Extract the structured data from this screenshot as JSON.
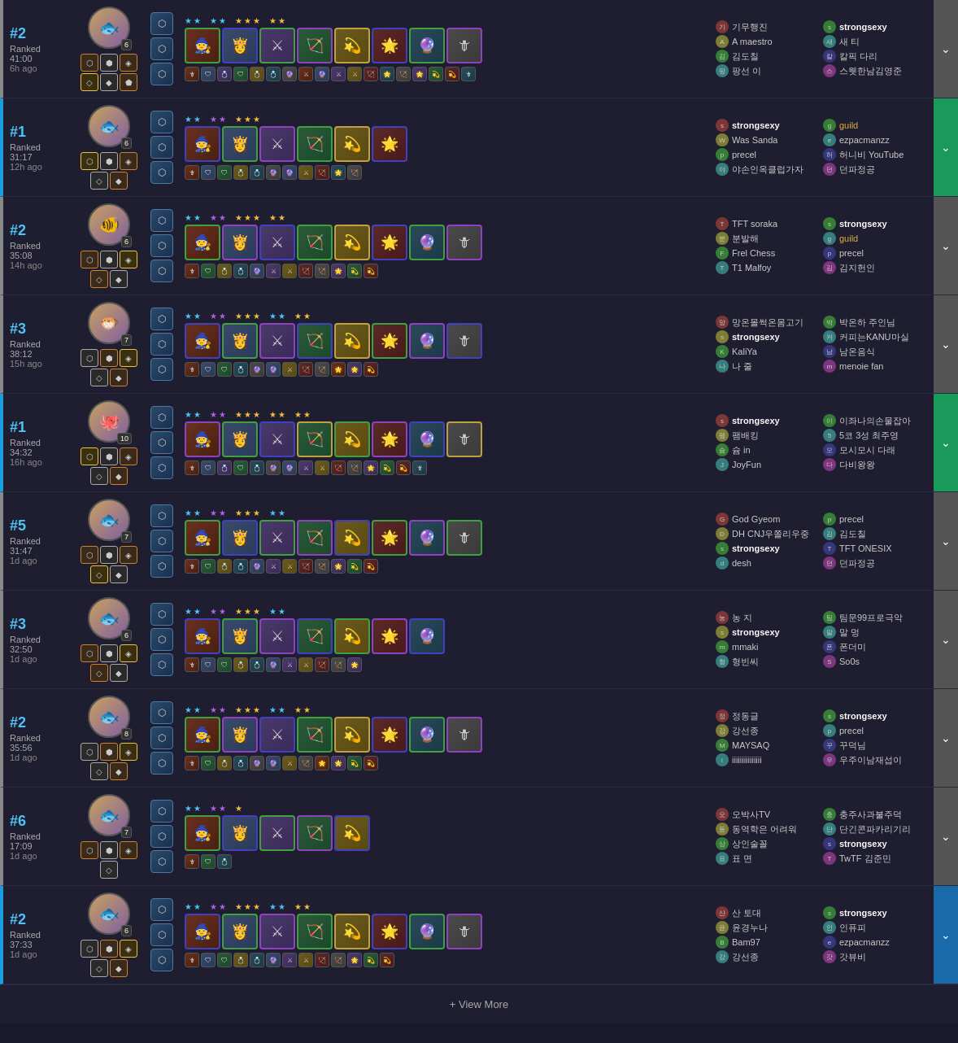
{
  "matches": [
    {
      "id": "match1",
      "rank": "#2",
      "rank_color": "blue",
      "type": "Ranked",
      "duration": "41:00",
      "ago": "6h ago",
      "avatar_emoji": "🐟",
      "avatar_level": 6,
      "traits": [
        "bronze",
        "silver",
        "bronze",
        "gold",
        "silver",
        "bronze"
      ],
      "augments": [
        "⬡",
        "⬡",
        "⬡"
      ],
      "stars_groups": [
        {
          "stars": 2,
          "color": "blue"
        },
        {
          "stars": 2,
          "color": "blue"
        },
        {
          "stars": 3,
          "color": "yellow"
        },
        {
          "stars": 2,
          "color": "yellow"
        }
      ],
      "champions": [
        "🧙",
        "👸",
        "🗡",
        "🏹",
        "💫",
        "🌟",
        "⚔",
        "🔮"
      ],
      "champ_tiers": [
        "tier2",
        "tier3",
        "tier2",
        "tier4",
        "tier5",
        "tier3",
        "tier2",
        "tier4"
      ],
      "items": [
        [
          "🗡",
          "🛡",
          "💍"
        ],
        [
          "🗡",
          "🔮"
        ],
        [
          "💍",
          "⚔",
          "🛡"
        ],
        [
          "🗡",
          "💍"
        ],
        [
          "💍",
          "🔮",
          "⚔"
        ],
        [
          "🗡"
        ],
        [
          "🛡",
          "💍"
        ],
        [
          "🔮",
          "⚔"
        ]
      ],
      "players_left": [
        "기무행진",
        "A maestro",
        "김도칠",
        "팡선 이"
      ],
      "players_right": [
        "strongsexy",
        "새 티",
        "칼픽 다리",
        "스웻한남김영준"
      ],
      "expand_color": "gray",
      "result": "loss"
    },
    {
      "id": "match2",
      "rank": "#1",
      "rank_color": "blue",
      "type": "Ranked",
      "duration": "31:17",
      "ago": "12h ago",
      "avatar_emoji": "🐟",
      "avatar_level": 6,
      "traits": [
        "gold",
        "silver",
        "bronze",
        "silver",
        "bronze"
      ],
      "augments": [
        "⬡",
        "⬡",
        "⬡"
      ],
      "stars_groups": [
        {
          "stars": 2,
          "color": "blue"
        },
        {
          "stars": 2,
          "color": "purple"
        },
        {
          "stars": 3,
          "color": "yellow"
        }
      ],
      "champions": [
        "🧙",
        "👸",
        "🗡",
        "🏹",
        "💫",
        "🌟"
      ],
      "champ_tiers": [
        "tier3",
        "tier2",
        "tier4",
        "tier2",
        "tier5",
        "tier3"
      ],
      "items": [
        [
          "🗡",
          "🛡"
        ],
        [
          "💍",
          "🔮"
        ],
        [
          "⚔",
          "💍"
        ],
        [
          "🗡"
        ],
        [
          "💍",
          "🔮",
          "⚔"
        ],
        [
          "🛡"
        ]
      ],
      "players_left": [
        "strongsexy",
        "Was Sanda",
        "precel",
        "야손인옥클럽가자"
      ],
      "players_right": [
        "guild",
        "ezpacmanzz",
        "허니비 YouTube",
        "던파정공"
      ],
      "expand_color": "green",
      "result": "win"
    },
    {
      "id": "match3",
      "rank": "#2",
      "rank_color": "blue",
      "type": "Ranked",
      "duration": "35:08",
      "ago": "14h ago",
      "avatar_emoji": "🐠",
      "avatar_level": 6,
      "traits": [
        "bronze",
        "silver",
        "gold",
        "bronze",
        "silver"
      ],
      "augments": [
        "⬡",
        "⬡",
        "⬡"
      ],
      "stars_groups": [
        {
          "stars": 2,
          "color": "blue"
        },
        {
          "stars": 2,
          "color": "purple"
        },
        {
          "stars": 3,
          "color": "yellow"
        },
        {
          "stars": 2,
          "color": "yellow"
        }
      ],
      "champions": [
        "🧙",
        "👸",
        "🗡",
        "🏹",
        "💫",
        "🌟",
        "⚔",
        "🔮"
      ],
      "champ_tiers": [
        "tier2",
        "tier4",
        "tier3",
        "tier2",
        "tier5",
        "tier3",
        "tier2",
        "tier4"
      ],
      "items": [
        [
          "🗡"
        ],
        [
          "🛡",
          "💍"
        ],
        [
          "🔮"
        ],
        [
          "🗡",
          "⚔"
        ],
        [
          "💍",
          "🔮"
        ],
        [
          "🛡"
        ],
        [
          "⚔",
          "💍"
        ],
        [
          "🔮"
        ]
      ],
      "players_left": [
        "TFT soraka",
        "분발해",
        "Frel Chess",
        "T1 Malfoy"
      ],
      "players_right": [
        "strongsexy",
        "guild",
        "precel",
        "김지헌인"
      ],
      "expand_color": "gray",
      "result": "loss"
    },
    {
      "id": "match4",
      "rank": "#3",
      "rank_color": "blue",
      "type": "Ranked",
      "duration": "38:12",
      "ago": "15h ago",
      "avatar_emoji": "🐡",
      "avatar_level": 7,
      "traits": [
        "silver",
        "bronze",
        "gold",
        "silver",
        "bronze"
      ],
      "augments": [
        "⬡",
        "⬡",
        "⬡"
      ],
      "stars_groups": [
        {
          "stars": 2,
          "color": "blue"
        },
        {
          "stars": 2,
          "color": "purple"
        },
        {
          "stars": 3,
          "color": "yellow"
        },
        {
          "stars": 2,
          "color": "blue"
        },
        {
          "stars": 2,
          "color": "yellow"
        }
      ],
      "champions": [
        "🧙",
        "👸",
        "🗡",
        "🏹",
        "💫",
        "🌟",
        "⚔",
        "🔮"
      ],
      "champ_tiers": [
        "tier3",
        "tier2",
        "tier4",
        "tier3",
        "tier5",
        "tier2",
        "tier4",
        "tier3"
      ],
      "items": [
        [
          "🗡",
          "🛡"
        ],
        [
          "💍"
        ],
        [
          "🔮",
          "⚔"
        ],
        [
          "🗡"
        ],
        [
          "💍",
          "🔮"
        ],
        [
          "🛡",
          "⚔"
        ],
        [
          "💍"
        ],
        [
          "🔮"
        ]
      ],
      "players_left": [
        "망온몰썩온몸고기",
        "strongsexy",
        "KaliYa",
        "나 줄"
      ],
      "players_right": [
        "박온하 주인님",
        "커피는KANU마실",
        "남온음식",
        "menoie fan"
      ],
      "expand_color": "gray",
      "result": "loss"
    },
    {
      "id": "match5",
      "rank": "#1",
      "rank_color": "blue",
      "type": "Ranked",
      "duration": "34:32",
      "ago": "16h ago",
      "avatar_emoji": "🐙",
      "avatar_level": 10,
      "traits": [
        "gold",
        "silver",
        "bronze",
        "silver",
        "bronze"
      ],
      "augments": [
        "⬡",
        "⬡",
        "⬡"
      ],
      "stars_groups": [
        {
          "stars": 2,
          "color": "blue"
        },
        {
          "stars": 2,
          "color": "purple"
        },
        {
          "stars": 3,
          "color": "yellow"
        },
        {
          "stars": 2,
          "color": "yellow"
        },
        {
          "stars": 2,
          "color": "yellow"
        }
      ],
      "champions": [
        "🧙",
        "👸",
        "🗡",
        "🏹",
        "💫",
        "🌟",
        "⚔",
        "🔮"
      ],
      "champ_tiers": [
        "tier4",
        "tier2",
        "tier3",
        "tier5",
        "tier2",
        "tier4",
        "tier3",
        "tier5"
      ],
      "items": [
        [
          "🗡",
          "🛡",
          "💍"
        ],
        [
          "🔮"
        ],
        [
          "⚔",
          "💍"
        ],
        [
          "🗡",
          "🛡"
        ],
        [
          "💍",
          "🔮"
        ],
        [
          "⚔"
        ],
        [
          "🗡",
          "💍"
        ],
        [
          "🔮",
          "⚔"
        ]
      ],
      "players_left": [
        "strongsexy",
        "팸배킹",
        "슘 in",
        "JoyFun"
      ],
      "players_right": [
        "이좌나의손물잡아",
        "5코 3성 최주영",
        "모시모시 다래",
        "다비왕왕"
      ],
      "expand_color": "green",
      "result": "win"
    },
    {
      "id": "match6",
      "rank": "#5",
      "rank_color": "blue",
      "type": "Ranked",
      "duration": "31:47",
      "ago": "1d ago",
      "avatar_emoji": "🐟",
      "avatar_level": 7,
      "traits": [
        "bronze",
        "silver",
        "bronze",
        "gold",
        "silver"
      ],
      "augments": [
        "⬡",
        "⬡",
        "⬡"
      ],
      "stars_groups": [
        {
          "stars": 2,
          "color": "blue"
        },
        {
          "stars": 2,
          "color": "purple"
        },
        {
          "stars": 3,
          "color": "yellow"
        },
        {
          "stars": 2,
          "color": "blue"
        }
      ],
      "champions": [
        "🧙",
        "👸",
        "🗡",
        "🏹",
        "💫",
        "🌟",
        "⚔",
        "🔮"
      ],
      "champ_tiers": [
        "tier2",
        "tier3",
        "tier2",
        "tier4",
        "tier3",
        "tier2",
        "tier4",
        "tier2"
      ],
      "items": [
        [
          "🗡"
        ],
        [
          "🛡",
          "💍"
        ],
        [
          "🔮"
        ],
        [
          "⚔",
          "💍"
        ],
        [
          "🗡",
          "🔮"
        ],
        [
          "🛡"
        ],
        [
          "💍",
          "⚔"
        ],
        [
          "🔮"
        ]
      ],
      "players_left": [
        "God Gyeom",
        "DH CNJ우쫄리우중",
        "strongsexy",
        "desh"
      ],
      "players_right": [
        "precel",
        "김도칠",
        "TFT ONESIX",
        "던파정공"
      ],
      "expand_color": "gray",
      "result": "loss"
    },
    {
      "id": "match7",
      "rank": "#3",
      "rank_color": "blue",
      "type": "Ranked",
      "duration": "32:50",
      "ago": "1d ago",
      "avatar_emoji": "🐟",
      "avatar_level": 6,
      "traits": [
        "bronze",
        "silver",
        "gold",
        "bronze",
        "silver"
      ],
      "augments": [
        "⬡",
        "⬡",
        "⬡"
      ],
      "stars_groups": [
        {
          "stars": 2,
          "color": "blue"
        },
        {
          "stars": 2,
          "color": "purple"
        },
        {
          "stars": 3,
          "color": "yellow"
        },
        {
          "stars": 2,
          "color": "blue"
        }
      ],
      "champions": [
        "🧙",
        "👸",
        "🗡",
        "🏹",
        "💫",
        "🌟",
        "⚔"
      ],
      "champ_tiers": [
        "tier3",
        "tier2",
        "tier4",
        "tier3",
        "tier2",
        "tier4",
        "tier3"
      ],
      "items": [
        [
          "🗡",
          "🛡"
        ],
        [
          "💍",
          "🔮"
        ],
        [
          "⚔"
        ],
        [
          "🗡",
          "💍"
        ],
        [
          "🔮",
          "⚔"
        ],
        [
          "🛡"
        ],
        [
          "💍"
        ]
      ],
      "players_left": [
        "농 지",
        "strongsexy",
        "mmaki",
        "형빈씨"
      ],
      "players_right": [
        "팀문99프로극악",
        "말 멍",
        "폰더미",
        "So0s"
      ],
      "expand_color": "gray",
      "result": "loss"
    },
    {
      "id": "match8",
      "rank": "#2",
      "rank_color": "blue",
      "type": "Ranked",
      "duration": "35:56",
      "ago": "1d ago",
      "avatar_emoji": "🐟",
      "avatar_level": 8,
      "traits": [
        "silver",
        "bronze",
        "gold",
        "silver",
        "bronze"
      ],
      "augments": [
        "⬡",
        "⬡",
        "⬡"
      ],
      "stars_groups": [
        {
          "stars": 2,
          "color": "blue"
        },
        {
          "stars": 2,
          "color": "purple"
        },
        {
          "stars": 3,
          "color": "yellow"
        },
        {
          "stars": 2,
          "color": "blue"
        },
        {
          "stars": 2,
          "color": "yellow"
        }
      ],
      "champions": [
        "🧙",
        "👸",
        "🗡",
        "🏹",
        "💫",
        "🌟",
        "⚔",
        "🔮"
      ],
      "champ_tiers": [
        "tier2",
        "tier4",
        "tier3",
        "tier2",
        "tier5",
        "tier3",
        "tier2",
        "tier4"
      ],
      "items": [
        [
          "🗡"
        ],
        [
          "🛡",
          "💍"
        ],
        [
          "🔮",
          "⚔"
        ],
        [
          "🗡"
        ],
        [
          "💍"
        ],
        [
          "🔮",
          "⚔"
        ],
        [
          "🛡",
          "💍"
        ],
        [
          "🔮"
        ]
      ],
      "players_left": [
        "정동글",
        "강선종",
        "MAYSAQ",
        "iiiiiiiiiiiiiii"
      ],
      "players_right": [
        "strongsexy",
        "precel",
        "꾸덕님",
        "우주이남재섭이"
      ],
      "expand_color": "gray",
      "result": "loss"
    },
    {
      "id": "match9",
      "rank": "#6",
      "rank_color": "blue",
      "type": "Ranked",
      "duration": "17:09",
      "ago": "1d ago",
      "avatar_emoji": "🐟",
      "avatar_level": 7,
      "traits": [
        "bronze",
        "silver",
        "bronze",
        "silver"
      ],
      "augments": [
        "⬡",
        "⬡",
        "⬡"
      ],
      "stars_groups": [
        {
          "stars": 2,
          "color": "blue"
        },
        {
          "stars": 2,
          "color": "purple"
        },
        {
          "stars": 1,
          "color": "yellow"
        }
      ],
      "champions": [
        "🧙",
        "👸",
        "🗡",
        "🏹",
        "💫"
      ],
      "champ_tiers": [
        "tier2",
        "tier3",
        "tier2",
        "tier4",
        "tier3"
      ],
      "items": [
        [
          "🗡"
        ],
        [
          "🛡"
        ],
        [
          "🔮"
        ]
      ],
      "players_left": [
        "오박사TV",
        "동역학은 어려워",
        "상인술꼴",
        "표 면"
      ],
      "players_right": [
        "충주사과불주덕",
        "단긴콘파카리기리",
        "strongsexy",
        "TwTF 김준민"
      ],
      "expand_color": "gray",
      "result": "loss"
    },
    {
      "id": "match10",
      "rank": "#2",
      "rank_color": "blue",
      "type": "Ranked",
      "duration": "37:33",
      "ago": "1d ago",
      "avatar_emoji": "🐟",
      "avatar_level": 6,
      "traits": [
        "silver",
        "bronze",
        "gold",
        "silver",
        "bronze"
      ],
      "augments": [
        "⬡",
        "⬡",
        "⬡"
      ],
      "stars_groups": [
        {
          "stars": 2,
          "color": "blue"
        },
        {
          "stars": 2,
          "color": "purple"
        },
        {
          "stars": 3,
          "color": "yellow"
        },
        {
          "stars": 2,
          "color": "blue"
        },
        {
          "stars": 2,
          "color": "yellow"
        }
      ],
      "champions": [
        "🧙",
        "👸",
        "🗡",
        "🏹",
        "💫",
        "🌟",
        "⚔",
        "🔮"
      ],
      "champ_tiers": [
        "tier3",
        "tier2",
        "tier4",
        "tier2",
        "tier5",
        "tier3",
        "tier2",
        "tier4"
      ],
      "items": [
        [
          "🗡",
          "🛡"
        ],
        [
          "💍",
          "🔮"
        ],
        [
          "⚔"
        ],
        [
          "🗡",
          "💍"
        ],
        [
          "🔮",
          "⚔"
        ],
        [
          "🛡"
        ],
        [
          "💍",
          "🗡"
        ],
        [
          "🔮"
        ]
      ],
      "players_left": [
        "산 토대",
        "윤경누나",
        "Bam97",
        "강선종"
      ],
      "players_right": [
        "strongsexy",
        "인퓨피",
        "ezpacmanzz",
        "갓뷰비"
      ],
      "expand_color": "blue",
      "result": "win"
    }
  ],
  "view_more_label": "+ View More",
  "champion_colors": [
    "c1",
    "c2",
    "c3",
    "c4",
    "c5",
    "c6",
    "c7",
    "c8"
  ]
}
